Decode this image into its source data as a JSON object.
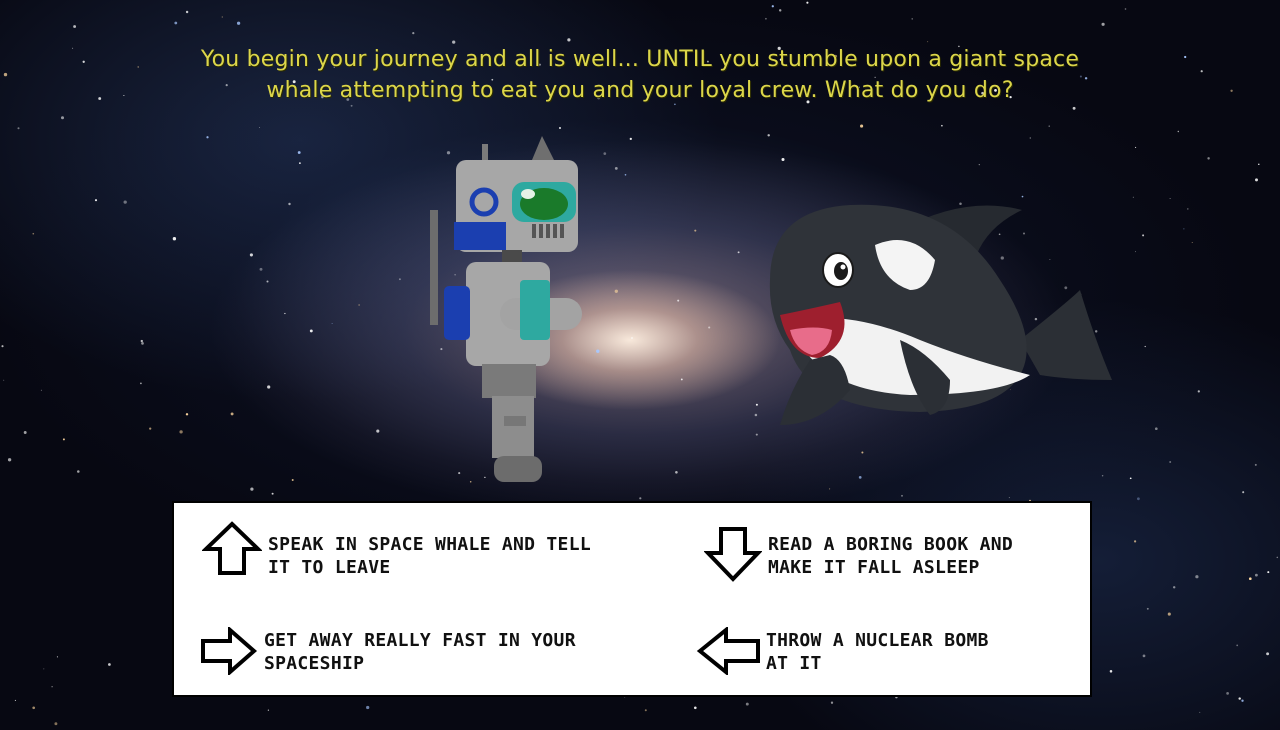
{
  "narration": {
    "line1": "You begin your journey and all is well... UNTIL you stumble upon a giant space",
    "line2": "whale attempting to eat you and your loyal crew. What do you do?"
  },
  "colors": {
    "narration_text": "#dcd64a",
    "panel_bg": "#ffffff",
    "choice_text": "#111111"
  },
  "characters": {
    "robot": "robot-astronaut",
    "whale": "orca-space-whale"
  },
  "choices": [
    {
      "key": "up",
      "icon": "arrow-up-icon",
      "line1": "SPEAK IN SPACE WHALE AND TELL",
      "line2": "IT TO LEAVE"
    },
    {
      "key": "down",
      "icon": "arrow-down-icon",
      "line1": "READ A BORING BOOK AND",
      "line2": "MAKE IT FALL ASLEEP"
    },
    {
      "key": "right",
      "icon": "arrow-right-icon",
      "line1": "GET AWAY REALLY FAST IN YOUR",
      "line2": "SPACESHIP"
    },
    {
      "key": "left",
      "icon": "arrow-left-icon",
      "line1": "THROW A NUCLEAR BOMB",
      "line2": "AT IT"
    }
  ]
}
